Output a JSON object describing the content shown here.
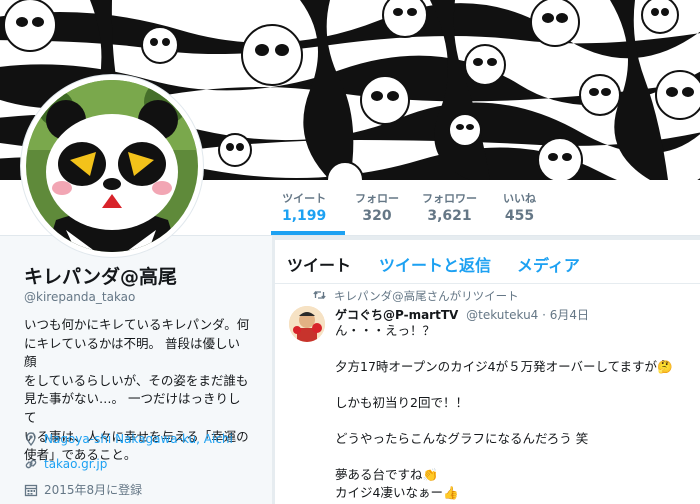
{
  "nav": {
    "stats": [
      {
        "label": "ツイート",
        "value": "1,199"
      },
      {
        "label": "フォロー",
        "value": "320"
      },
      {
        "label": "フォロワー",
        "value": "3,621"
      },
      {
        "label": "いいね",
        "value": "455"
      }
    ]
  },
  "profile": {
    "name": "キレパンダ@高尾",
    "handle": "@kirepanda_takao",
    "bio_lines": [
      "いつも何かにキレているキレパンダ。何",
      "にキレているかは不明。 普段は優しい顔",
      "をしているらしいが、その姿をまだ誰も",
      "見た事がない…。 一つだけはっきりして",
      "いる事は、人々に幸せを与える「幸運の",
      "使者」であること。"
    ],
    "location": "Nagoya-shi Nakagawa-ku, Aichi",
    "url": "takao.gr.jp",
    "joined": "2015年8月に登録"
  },
  "timeline": {
    "tabs": [
      "ツイート",
      "ツイートと返信",
      "メディア"
    ],
    "retweet_text": "キレパンダ@高尾さんがリツイート",
    "tweet": {
      "author": "ゲコぐち@P-martTV",
      "handle": "@tekuteku4",
      "date": "· 6月4日",
      "lines": [
        "ん・・・えっ！？",
        "",
        "夕方17時オープンのカイジ4が５万発オーバーしてますが🤔",
        "",
        "しかも初当り2回で！！",
        "",
        "どうやったらこんなグラフになるんだろう 笑",
        "",
        "夢ある台ですね👏",
        "カイジ4凄いなぁー👍"
      ]
    }
  },
  "colors": {
    "accent": "#1da1f2",
    "muted": "#657786",
    "bg": "#e6ecf0"
  },
  "icons": [
    "location-icon",
    "link-icon",
    "calendar-icon",
    "retweet-icon"
  ]
}
